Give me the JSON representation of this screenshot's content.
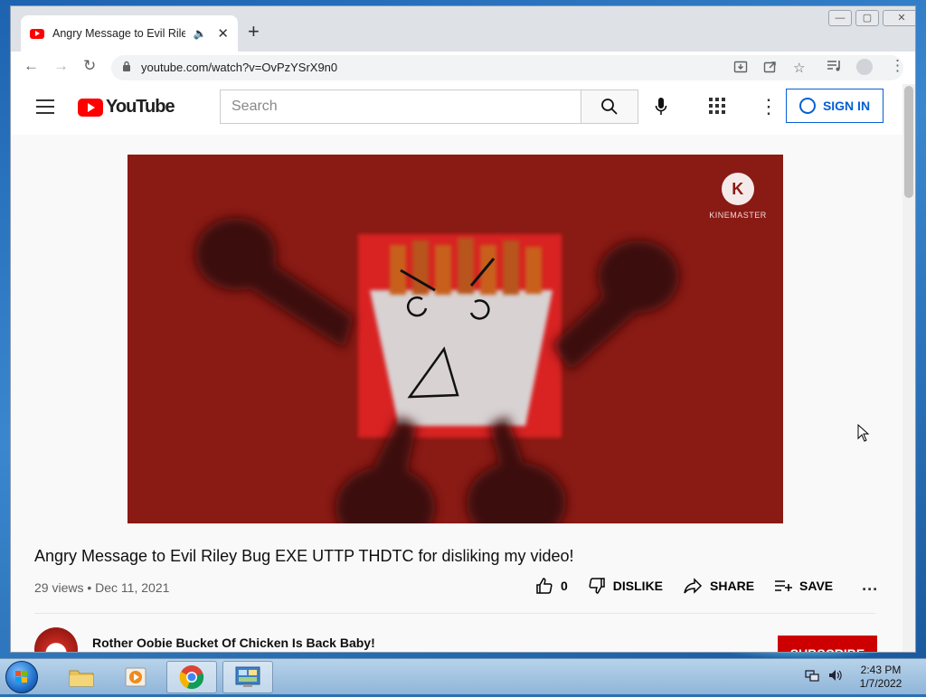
{
  "browser": {
    "tab_title": "Angry Message to Evil Riley",
    "tab_audio_icon": "speaker-icon",
    "new_tab_label": "+",
    "url": "youtube.com/watch?v=OvPzYSrX9n0",
    "window_controls": {
      "minimize": "—",
      "maximize": "▢",
      "close": "✕"
    }
  },
  "youtube": {
    "logo_text": "YouTube",
    "search_placeholder": "Search",
    "sign_in_label": "SIGN IN"
  },
  "video": {
    "watermark_letter": "K",
    "watermark_text": "KINEMASTER",
    "title": "Angry Message to Evil Riley Bug EXE UTTP THDTC for disliking my video!",
    "meta": "29 views • Dec 11, 2021",
    "like_count": "0",
    "dislike_label": "DISLIKE",
    "share_label": "SHARE",
    "save_label": "SAVE",
    "more_label": "..."
  },
  "channel": {
    "name": "Rother Oobie Bucket Of Chicken Is Back Baby!",
    "subscribe_label": "SUBSCRIBE"
  },
  "taskbar": {
    "time": "2:43 PM",
    "date": "1/7/2022"
  },
  "colors": {
    "youtube_red": "#ff0000",
    "video_background": "#8a1a14",
    "sign_in_blue": "#065fd4",
    "subscribe_red": "#cc0000"
  }
}
